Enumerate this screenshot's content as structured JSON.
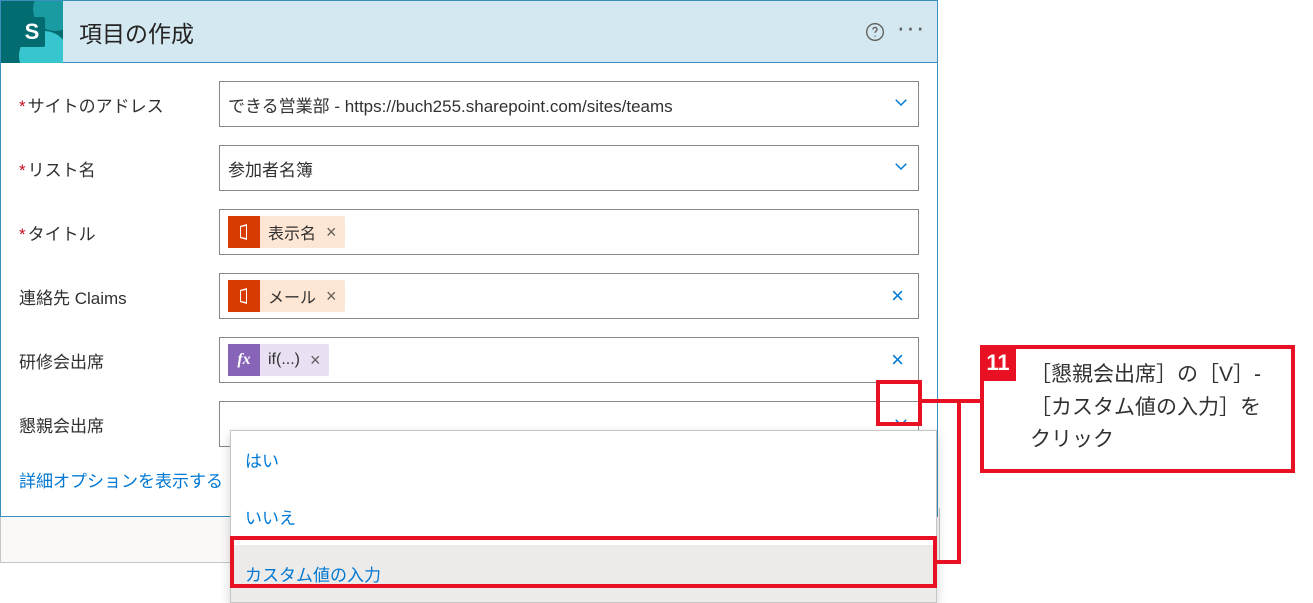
{
  "header": {
    "logo_letter": "S",
    "title": "項目の作成"
  },
  "fields": {
    "site_address": {
      "label": "サイトのアドレス",
      "value": "できる営業部 - https://buch255.sharepoint.com/sites/teams"
    },
    "list_name": {
      "label": "リスト名",
      "value": "参加者名簿"
    },
    "title_field": {
      "label": "タイトル",
      "token": "表示名"
    },
    "contact": {
      "label": "連絡先 Claims",
      "token": "メール"
    },
    "training": {
      "label": "研修会出席",
      "token": "if(...)"
    },
    "party": {
      "label": "懇親会出席",
      "value": ""
    }
  },
  "advanced_link": "詳細オプションを表示する",
  "dropdown": {
    "options": [
      "はい",
      "いいえ",
      "カスタム値の入力"
    ]
  },
  "callout": {
    "num": "11",
    "text": "［懇親会出席］の［V］-［カスタム値の入力］をクリック"
  }
}
